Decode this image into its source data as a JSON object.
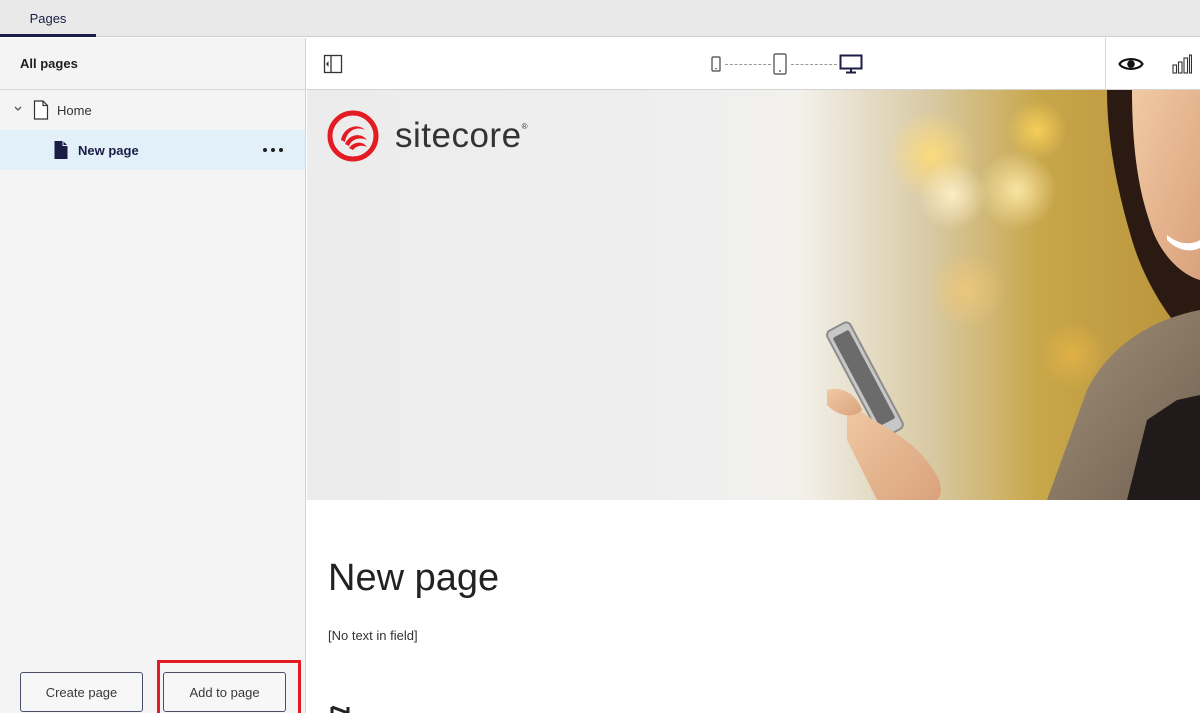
{
  "tabs": {
    "active_label": "Pages"
  },
  "sidebar": {
    "header": "All pages",
    "tree": [
      {
        "label": "Home",
        "expanded": true
      },
      {
        "label": "New page",
        "selected": true
      }
    ],
    "create_button": "Create page",
    "add_button": "Add to page"
  },
  "toolbar": {
    "icons": [
      "toggle-sidebar-icon",
      "mobile-icon",
      "tablet-icon",
      "desktop-icon",
      "preview-eye-icon",
      "analytics-icon"
    ],
    "active_device": "desktop"
  },
  "canvas": {
    "logo_text": "sitecore",
    "logo_mark": "®",
    "page_heading": "New page",
    "empty_field_text": "[No text in field]",
    "brand_color": "#e31c23"
  }
}
